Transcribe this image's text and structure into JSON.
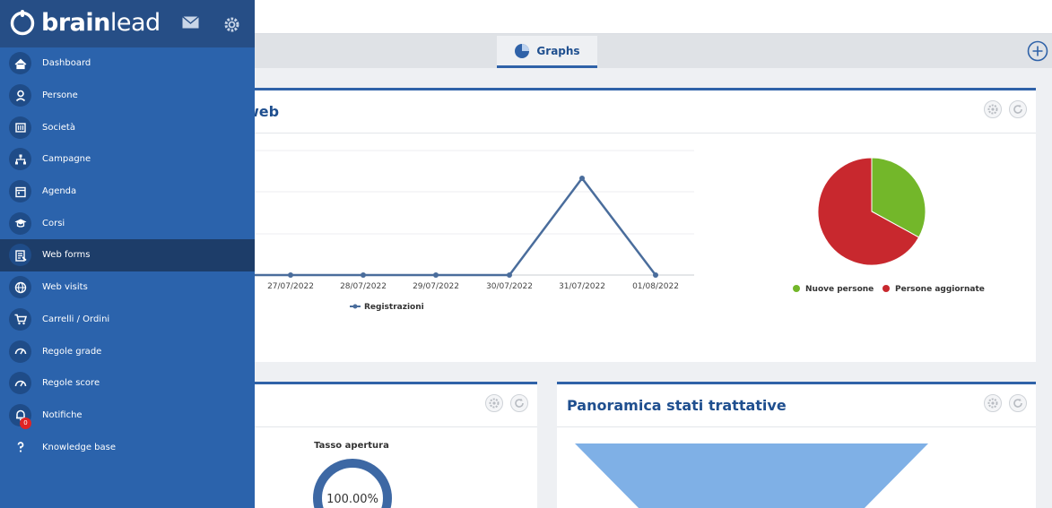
{
  "sidebar": {
    "brand": {
      "prefix": "brain",
      "suffix": "lead"
    },
    "items": [
      {
        "label": "Dashboard",
        "icon": "home-icon"
      },
      {
        "label": "Persone",
        "icon": "person-icon"
      },
      {
        "label": "Società",
        "icon": "building-icon"
      },
      {
        "label": "Campagne",
        "icon": "sitemap-icon"
      },
      {
        "label": "Agenda",
        "icon": "calendar-icon"
      },
      {
        "label": "Corsi",
        "icon": "graduation-cap-icon"
      },
      {
        "label": "Web forms",
        "icon": "form-icon"
      },
      {
        "label": "Web visits",
        "icon": "globe-icon"
      },
      {
        "label": "Carrelli / Ordini",
        "icon": "cart-icon"
      },
      {
        "label": "Regole grade",
        "icon": "gauge-icon"
      },
      {
        "label": "Regole score",
        "icon": "gauge-icon"
      },
      {
        "label": "Notifiche",
        "icon": "bell-icon",
        "badge": "0"
      },
      {
        "label": "Knowledge base",
        "icon": "question-icon"
      }
    ],
    "active_index": 6
  },
  "tabs": {
    "active_label": "Graphs"
  },
  "card_web": {
    "title_fragment": "web",
    "line_chart": {
      "x_labels": [
        "27/07/2022",
        "28/07/2022",
        "29/07/2022",
        "30/07/2022",
        "31/07/2022",
        "01/08/2022"
      ],
      "values": [
        0,
        0,
        0,
        0,
        1,
        0
      ],
      "legend": "Registrazioni"
    },
    "pie_chart": {
      "slices": [
        {
          "label": "Nuove persone",
          "value": 33,
          "color": "#73b72a"
        },
        {
          "label": "Persone aggiornate",
          "value": 67,
          "color": "#c8282e"
        }
      ]
    }
  },
  "card_email": {
    "subtitle": "Tasso apertura",
    "value": "100.00%",
    "ring_color": "#3d68a4"
  },
  "card_trattative": {
    "title": "Panoramica stati trattative",
    "funnel_color": "#7fb0e6"
  },
  "colors": {
    "sidebar": "#2b63ac",
    "accent": "#2f62a8",
    "title": "#1f4f8f"
  }
}
